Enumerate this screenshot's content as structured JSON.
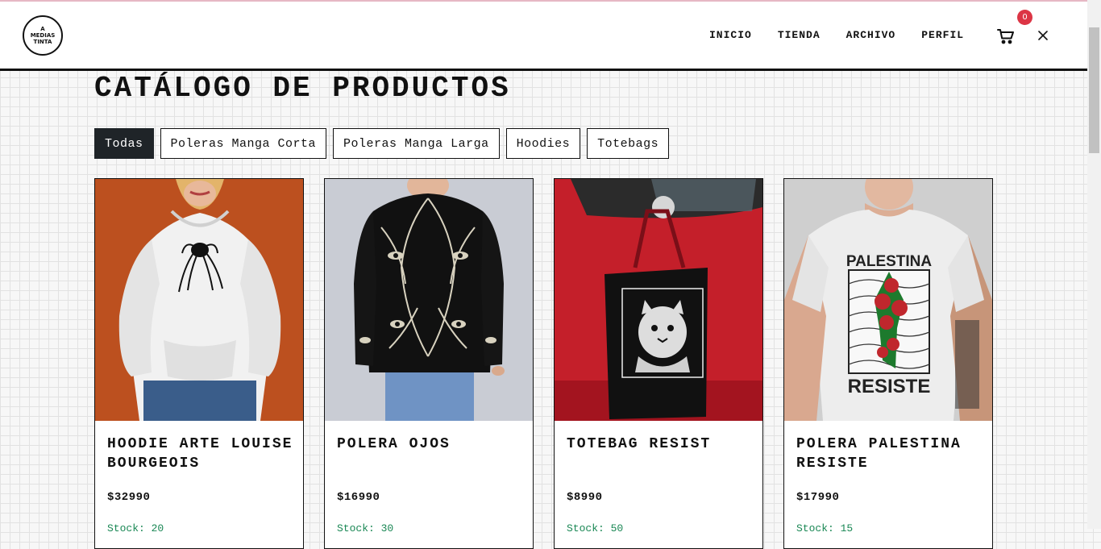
{
  "brand": {
    "logo_lines": [
      "A",
      "MEDIAS",
      "TINTA"
    ]
  },
  "nav": {
    "links": [
      {
        "label": "INICIO"
      },
      {
        "label": "TIENDA"
      },
      {
        "label": "ARCHIVO"
      },
      {
        "label": "PERFIL"
      }
    ],
    "cart_count": "0",
    "cart_icon": "cart-icon",
    "close_icon": "close-icon"
  },
  "catalog": {
    "title": "CATÁLOGO DE PRODUCTOS",
    "filters": [
      {
        "label": "Todas",
        "active": true
      },
      {
        "label": "Poleras Manga Corta",
        "active": false
      },
      {
        "label": "Poleras Manga Larga",
        "active": false
      },
      {
        "label": "Hoodies",
        "active": false
      },
      {
        "label": "Totebags",
        "active": false
      }
    ]
  },
  "products": [
    {
      "name": "HOODIE ARTE LOUISE BOURGEOIS",
      "price": "$32990",
      "stock": "Stock: 20",
      "image": "hoodie-photo"
    },
    {
      "name": "POLERA OJOS",
      "price": "$16990",
      "stock": "Stock: 30",
      "image": "longsleeve-photo"
    },
    {
      "name": "TOTEBAG RESIST",
      "price": "$8990",
      "stock": "Stock: 50",
      "image": "totebag-photo"
    },
    {
      "name": "POLERA PALESTINA RESISTE",
      "price": "$17990",
      "stock": "Stock: 15",
      "image": "tshirt-photo",
      "image_text": [
        "PALESTINA",
        "RESISTE"
      ]
    }
  ],
  "colors": {
    "accent": "#1f2428",
    "badge": "#dc3545",
    "stock": "#198754"
  }
}
